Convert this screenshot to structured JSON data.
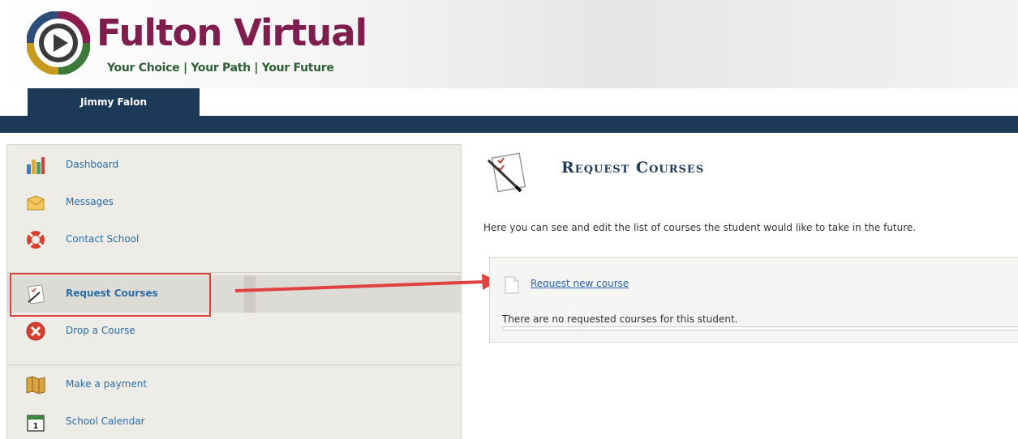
{
  "brand": {
    "name": "Fulton Virtual",
    "tagline": "Your Choice | Your Path | Your Future"
  },
  "user": {
    "name": "Jimmy Falon"
  },
  "sidebar": {
    "items": [
      {
        "label": "Dashboard",
        "icon": "bar-chart-icon"
      },
      {
        "label": "Messages",
        "icon": "envelope-icon"
      },
      {
        "label": "Contact School",
        "icon": "lifebuoy-icon"
      },
      {
        "label": "Request Courses",
        "icon": "checklist-icon",
        "active": true
      },
      {
        "label": "Drop a Course",
        "icon": "x-circle-icon"
      },
      {
        "label": "Make a payment",
        "icon": "map-icon"
      },
      {
        "label": "School Calendar",
        "icon": "calendar-icon"
      }
    ]
  },
  "main": {
    "title": "Request Courses",
    "description": "Here you can see and edit the list of courses the student would like to take in the future.",
    "request_link": "Request new course",
    "empty_message": "There are no requested courses for this student."
  },
  "colors": {
    "brand_maroon": "#7f1d4e",
    "brand_green": "#2f5f34",
    "nav_bar": "#1c3a58",
    "link_blue": "#2b6ea8",
    "annotation_red": "#e04141"
  }
}
